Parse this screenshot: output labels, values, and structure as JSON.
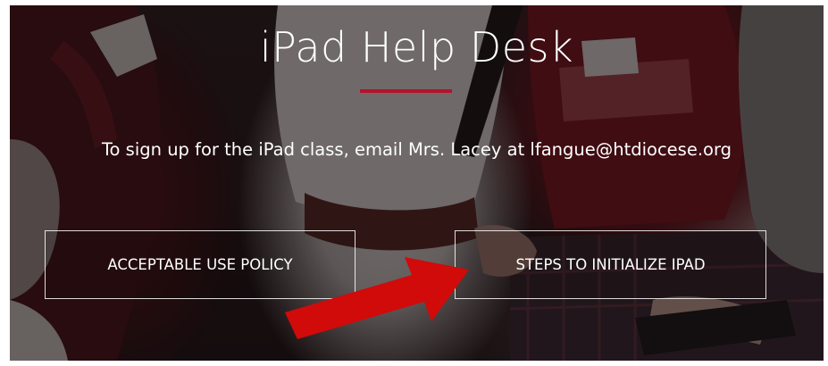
{
  "hero": {
    "title": "iPad Help Desk",
    "signup_text": "To sign up for the iPad class, email Mrs. Lacey at lfangue@htdiocese.org",
    "accent_color": "#b5122b"
  },
  "buttons": {
    "acceptable_use": "ACCEPTABLE USE POLICY",
    "initialize_ipad": "STEPS TO INITIALIZE IPAD"
  },
  "annotation": {
    "arrow_color": "#d10a0a",
    "arrow_icon": "red-arrow-icon"
  }
}
